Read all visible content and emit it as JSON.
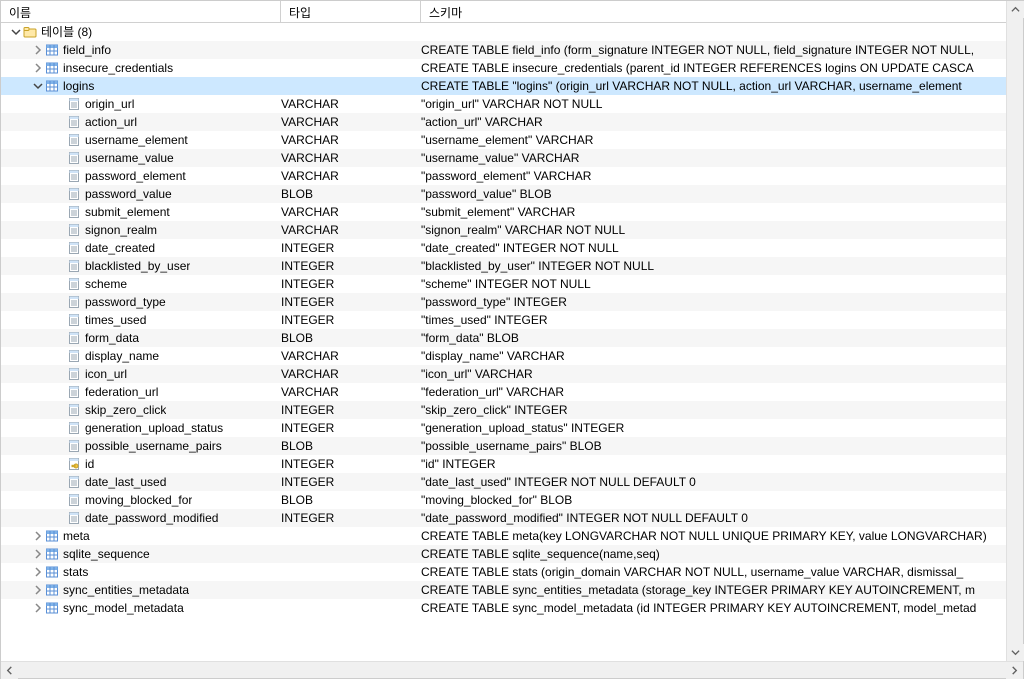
{
  "columns": {
    "name": "이름",
    "type": "타입",
    "schema": "스키마"
  },
  "rootLabel": "테이블 (8)",
  "rows": [
    {
      "depth": 0,
      "expander": "open",
      "icon": "folder",
      "name_bind": "rootLabel",
      "type": "",
      "schema": "",
      "alt": false
    },
    {
      "depth": 1,
      "expander": "closed",
      "icon": "table",
      "name": "field_info",
      "type": "",
      "schema": "CREATE TABLE field_info (form_signature INTEGER NOT NULL, field_signature INTEGER NOT NULL,",
      "alt": true
    },
    {
      "depth": 1,
      "expander": "closed",
      "icon": "table",
      "name": "insecure_credentials",
      "type": "",
      "schema": "CREATE TABLE insecure_credentials (parent_id INTEGER REFERENCES logins ON UPDATE CASCA",
      "alt": false
    },
    {
      "depth": 1,
      "expander": "open",
      "icon": "table",
      "name": "logins",
      "type": "",
      "schema": "CREATE TABLE \"logins\" (origin_url VARCHAR NOT NULL, action_url VARCHAR, username_element",
      "selected": true
    },
    {
      "depth": 2,
      "icon": "column",
      "name": "origin_url",
      "type": "VARCHAR",
      "schema": "\"origin_url\" VARCHAR NOT NULL",
      "alt": false
    },
    {
      "depth": 2,
      "icon": "column",
      "name": "action_url",
      "type": "VARCHAR",
      "schema": "\"action_url\" VARCHAR",
      "alt": true
    },
    {
      "depth": 2,
      "icon": "column",
      "name": "username_element",
      "type": "VARCHAR",
      "schema": "\"username_element\" VARCHAR",
      "alt": false
    },
    {
      "depth": 2,
      "icon": "column",
      "name": "username_value",
      "type": "VARCHAR",
      "schema": "\"username_value\" VARCHAR",
      "alt": true
    },
    {
      "depth": 2,
      "icon": "column",
      "name": "password_element",
      "type": "VARCHAR",
      "schema": "\"password_element\" VARCHAR",
      "alt": false
    },
    {
      "depth": 2,
      "icon": "column",
      "name": "password_value",
      "type": "BLOB",
      "schema": "\"password_value\" BLOB",
      "alt": true
    },
    {
      "depth": 2,
      "icon": "column",
      "name": "submit_element",
      "type": "VARCHAR",
      "schema": "\"submit_element\" VARCHAR",
      "alt": false
    },
    {
      "depth": 2,
      "icon": "column",
      "name": "signon_realm",
      "type": "VARCHAR",
      "schema": "\"signon_realm\" VARCHAR NOT NULL",
      "alt": true
    },
    {
      "depth": 2,
      "icon": "column",
      "name": "date_created",
      "type": "INTEGER",
      "schema": "\"date_created\" INTEGER NOT NULL",
      "alt": false
    },
    {
      "depth": 2,
      "icon": "column",
      "name": "blacklisted_by_user",
      "type": "INTEGER",
      "schema": "\"blacklisted_by_user\" INTEGER NOT NULL",
      "alt": true
    },
    {
      "depth": 2,
      "icon": "column",
      "name": "scheme",
      "type": "INTEGER",
      "schema": "\"scheme\" INTEGER NOT NULL",
      "alt": false
    },
    {
      "depth": 2,
      "icon": "column",
      "name": "password_type",
      "type": "INTEGER",
      "schema": "\"password_type\" INTEGER",
      "alt": true
    },
    {
      "depth": 2,
      "icon": "column",
      "name": "times_used",
      "type": "INTEGER",
      "schema": "\"times_used\" INTEGER",
      "alt": false
    },
    {
      "depth": 2,
      "icon": "column",
      "name": "form_data",
      "type": "BLOB",
      "schema": "\"form_data\" BLOB",
      "alt": true
    },
    {
      "depth": 2,
      "icon": "column",
      "name": "display_name",
      "type": "VARCHAR",
      "schema": "\"display_name\" VARCHAR",
      "alt": false
    },
    {
      "depth": 2,
      "icon": "column",
      "name": "icon_url",
      "type": "VARCHAR",
      "schema": "\"icon_url\" VARCHAR",
      "alt": true
    },
    {
      "depth": 2,
      "icon": "column",
      "name": "federation_url",
      "type": "VARCHAR",
      "schema": "\"federation_url\" VARCHAR",
      "alt": false
    },
    {
      "depth": 2,
      "icon": "column",
      "name": "skip_zero_click",
      "type": "INTEGER",
      "schema": "\"skip_zero_click\" INTEGER",
      "alt": true
    },
    {
      "depth": 2,
      "icon": "column",
      "name": "generation_upload_status",
      "type": "INTEGER",
      "schema": "\"generation_upload_status\" INTEGER",
      "alt": false
    },
    {
      "depth": 2,
      "icon": "column",
      "name": "possible_username_pairs",
      "type": "BLOB",
      "schema": "\"possible_username_pairs\" BLOB",
      "alt": true
    },
    {
      "depth": 2,
      "icon": "column-key",
      "name": "id",
      "type": "INTEGER",
      "schema": "\"id\" INTEGER",
      "alt": false
    },
    {
      "depth": 2,
      "icon": "column",
      "name": "date_last_used",
      "type": "INTEGER",
      "schema": "\"date_last_used\" INTEGER NOT NULL DEFAULT 0",
      "alt": true
    },
    {
      "depth": 2,
      "icon": "column",
      "name": "moving_blocked_for",
      "type": "BLOB",
      "schema": "\"moving_blocked_for\" BLOB",
      "alt": false
    },
    {
      "depth": 2,
      "icon": "column",
      "name": "date_password_modified",
      "type": "INTEGER",
      "schema": "\"date_password_modified\" INTEGER NOT NULL DEFAULT 0",
      "alt": true
    },
    {
      "depth": 1,
      "expander": "closed",
      "icon": "table",
      "name": "meta",
      "type": "",
      "schema": "CREATE TABLE meta(key LONGVARCHAR NOT NULL UNIQUE PRIMARY KEY, value LONGVARCHAR)",
      "alt": false
    },
    {
      "depth": 1,
      "expander": "closed",
      "icon": "table",
      "name": "sqlite_sequence",
      "type": "",
      "schema": "CREATE TABLE sqlite_sequence(name,seq)",
      "alt": true
    },
    {
      "depth": 1,
      "expander": "closed",
      "icon": "table",
      "name": "stats",
      "type": "",
      "schema": "CREATE TABLE stats (origin_domain VARCHAR NOT NULL, username_value VARCHAR, dismissal_",
      "alt": false
    },
    {
      "depth": 1,
      "expander": "closed",
      "icon": "table",
      "name": "sync_entities_metadata",
      "type": "",
      "schema": "CREATE TABLE sync_entities_metadata (storage_key INTEGER PRIMARY KEY AUTOINCREMENT, m",
      "alt": true
    },
    {
      "depth": 1,
      "expander": "closed",
      "icon": "table",
      "name": "sync_model_metadata",
      "type": "",
      "schema": "CREATE TABLE sync_model_metadata (id INTEGER PRIMARY KEY AUTOINCREMENT, model_metad",
      "alt": false
    }
  ]
}
